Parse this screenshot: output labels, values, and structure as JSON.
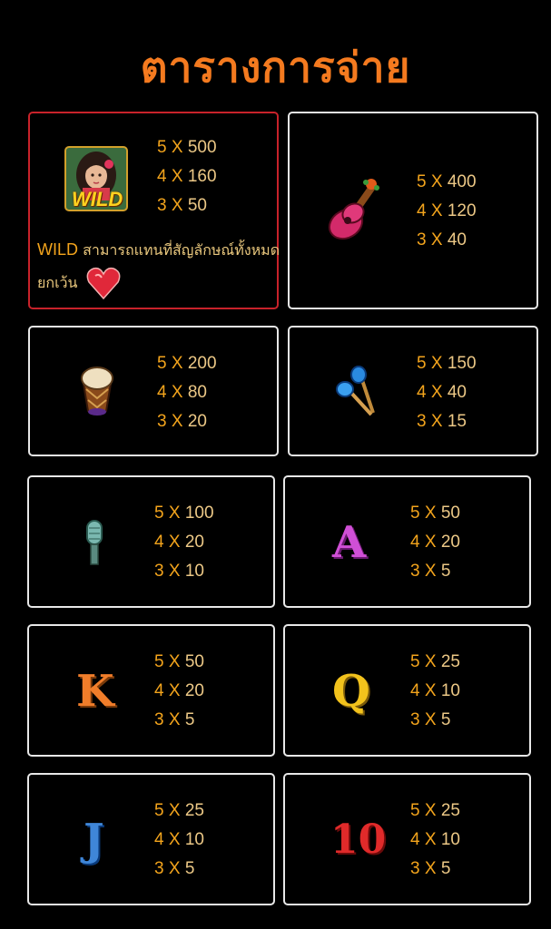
{
  "title": "ตารางการจ่าย",
  "wild_note": {
    "prefix": "WILD",
    "text": " สามารถแทนที่สัญลักษณ์ทั้งหมด",
    "line2": "ยกเว้น"
  },
  "cards": [
    {
      "symbol": "wild-girl-icon",
      "wild_label": "WILD",
      "pays": [
        {
          "count": "5",
          "mult": "500"
        },
        {
          "count": "4",
          "mult": "160"
        },
        {
          "count": "3",
          "mult": "50"
        }
      ]
    },
    {
      "symbol": "guitar-icon",
      "pays": [
        {
          "count": "5",
          "mult": "400"
        },
        {
          "count": "4",
          "mult": "120"
        },
        {
          "count": "3",
          "mult": "40"
        }
      ]
    },
    {
      "symbol": "drum-icon",
      "pays": [
        {
          "count": "5",
          "mult": "200"
        },
        {
          "count": "4",
          "mult": "80"
        },
        {
          "count": "3",
          "mult": "20"
        }
      ]
    },
    {
      "symbol": "maracas-icon",
      "pays": [
        {
          "count": "5",
          "mult": "150"
        },
        {
          "count": "4",
          "mult": "40"
        },
        {
          "count": "3",
          "mult": "15"
        }
      ]
    },
    {
      "symbol": "microphone-icon",
      "pays": [
        {
          "count": "5",
          "mult": "100"
        },
        {
          "count": "4",
          "mult": "20"
        },
        {
          "count": "3",
          "mult": "10"
        }
      ]
    },
    {
      "symbol": "letter-a-icon",
      "letter": "A",
      "color": "#d04fd6",
      "pays": [
        {
          "count": "5",
          "mult": "50"
        },
        {
          "count": "4",
          "mult": "20"
        },
        {
          "count": "3",
          "mult": "5"
        }
      ]
    },
    {
      "symbol": "letter-k-icon",
      "letter": "K",
      "color": "#f07d2a",
      "pays": [
        {
          "count": "5",
          "mult": "50"
        },
        {
          "count": "4",
          "mult": "20"
        },
        {
          "count": "3",
          "mult": "5"
        }
      ]
    },
    {
      "symbol": "letter-q-icon",
      "letter": "Q",
      "color": "#f2c21c",
      "pays": [
        {
          "count": "5",
          "mult": "25"
        },
        {
          "count": "4",
          "mult": "10"
        },
        {
          "count": "3",
          "mult": "5"
        }
      ]
    },
    {
      "symbol": "letter-j-icon",
      "letter": "J",
      "color": "#3f86d8",
      "pays": [
        {
          "count": "5",
          "mult": "25"
        },
        {
          "count": "4",
          "mult": "10"
        },
        {
          "count": "3",
          "mult": "5"
        }
      ]
    },
    {
      "symbol": "number-10-icon",
      "letter": "10",
      "color": "#e02a2a",
      "pays": [
        {
          "count": "5",
          "mult": "25"
        },
        {
          "count": "4",
          "mult": "10"
        },
        {
          "count": "3",
          "mult": "5"
        }
      ]
    }
  ],
  "x_label": "X"
}
